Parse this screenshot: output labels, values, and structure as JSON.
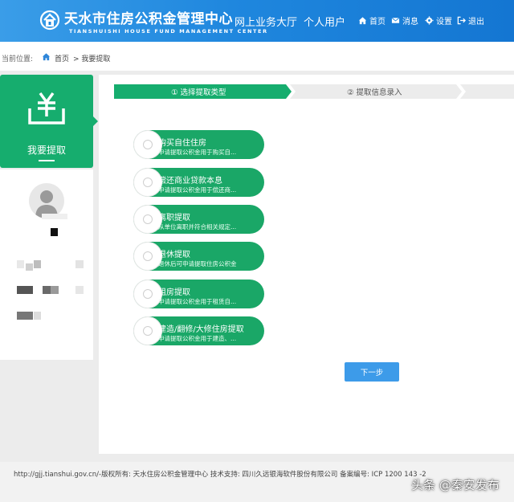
{
  "header": {
    "site_name": "天水市住房公积金管理中心",
    "site_name_en": "TIANSHUISHI   HOUSE   FUND   MANAGEMENT   CENTER",
    "hall": "网上业务大厅",
    "personal": "个人用户",
    "nav": {
      "home": "首页",
      "messages": "消息",
      "settings": "设置",
      "logout": "退出"
    }
  },
  "breadcrumb": {
    "lead": "当前位置:",
    "home": "首页",
    "current": "> 我要提取"
  },
  "sidebar": {
    "title": "我要提取"
  },
  "steps": [
    {
      "label": "① 选择提取类型",
      "active": true
    },
    {
      "label": "② 提取信息录入",
      "active": false
    }
  ],
  "options": [
    {
      "title": "购买自住住房",
      "desc": "申请提取公积金用于购买自..."
    },
    {
      "title": "偿还商业贷款本息",
      "desc": "申请提取公积金用于偿还商..."
    },
    {
      "title": "离职提取",
      "desc": "从单位离职并符合相关规定..."
    },
    {
      "title": "退休提取",
      "desc": "退休后可申请提取住房公积金"
    },
    {
      "title": "租房提取",
      "desc": "申请提取公积金用于租赁自..."
    },
    {
      "title": "建造/翻修/大修住房提取",
      "desc": "申请提取公积金用于建造、..."
    }
  ],
  "next_button": "下一步",
  "footer": {
    "text": "http://gjj.tianshui.gov.cn/-版权所有:   天水住房公积金管理中心   技术支持:   四川久远银海软件股份有限公司        备案编号:     ICP 1200 143  -2"
  },
  "watermark": "头条 @秦安发布",
  "colors": {
    "header_blue": "#1f87de",
    "accent_green": "#1aa767",
    "button_blue": "#3d9be9"
  }
}
